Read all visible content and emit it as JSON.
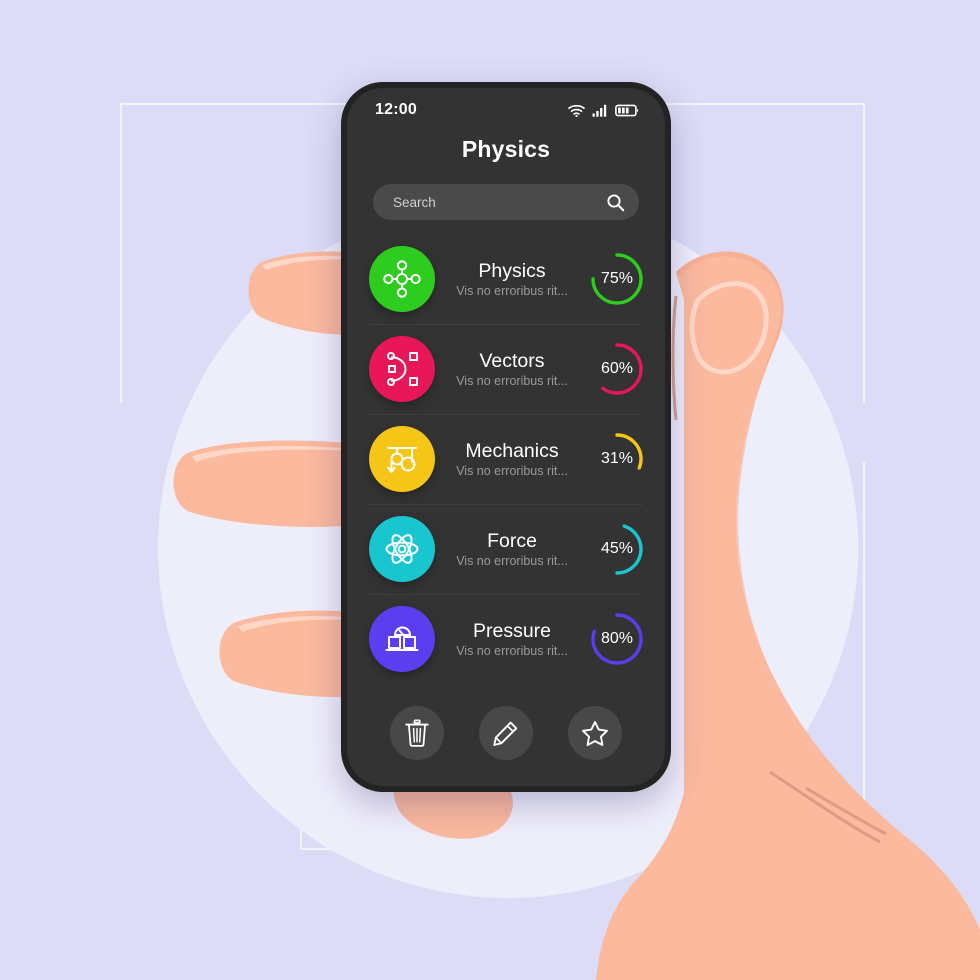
{
  "status_bar": {
    "time": "12:00",
    "icons": [
      "wifi-icon",
      "cellular-signal-icon",
      "battery-icon"
    ]
  },
  "header": {
    "title": "Physics"
  },
  "search": {
    "placeholder": "Search",
    "value": "Search",
    "icon": "search-icon"
  },
  "list": {
    "items": [
      {
        "title": "Physics",
        "subtitle": "Vis no erroribus rit...",
        "percent": "75%",
        "value": 75,
        "color": "#2fcc20",
        "icon": "molecule-icon",
        "direction": "clockwise"
      },
      {
        "title": "Vectors",
        "subtitle": "Vis no erroribus rit...",
        "percent": "60%",
        "value": 60,
        "color": "#e8175a",
        "icon": "bezier-curve-icon",
        "direction": "clockwise"
      },
      {
        "title": "Mechanics",
        "subtitle": "Vis no erroribus rit...",
        "percent": "31%",
        "value": 31,
        "color": "#f5c518",
        "icon": "pulley-icon",
        "direction": "clockwise"
      },
      {
        "title": "Force",
        "subtitle": "Vis no erroribus rit...",
        "percent": "45%",
        "value": 45,
        "color": "#19c6cf",
        "icon": "atom-icon",
        "direction": "counter-clockwise"
      },
      {
        "title": "Pressure",
        "subtitle": "Vis no erroribus rit...",
        "percent": "80%",
        "value": 80,
        "color": "#5b3ef0",
        "icon": "pressure-gauge-icon",
        "direction": "clockwise"
      }
    ]
  },
  "actions": [
    {
      "name": "delete",
      "icon": "trash-icon"
    },
    {
      "name": "edit",
      "icon": "pencil-icon"
    },
    {
      "name": "favorite",
      "icon": "star-icon"
    }
  ],
  "theme": {
    "page_background": "#dcdcf7",
    "circle_background": "#eeeefb",
    "phone_body": "#232323",
    "screen_background": "#333333",
    "search_background": "#4a4a4a",
    "action_button_background": "#484848",
    "skin": "#fbb99e",
    "skin_shadow": "#f6a98c",
    "nail_line": "#ffd7c6"
  }
}
